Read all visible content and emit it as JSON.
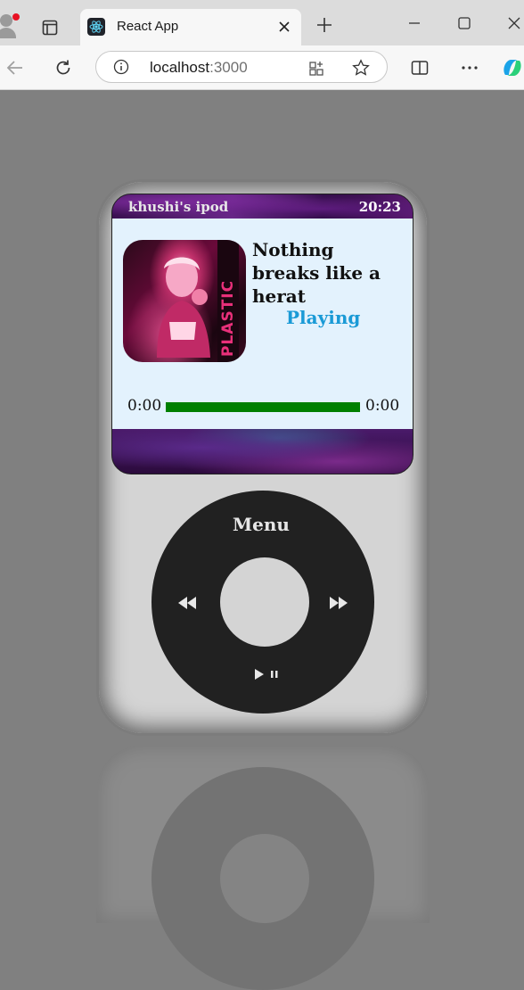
{
  "browser": {
    "tab_title": "React App",
    "url_host": "localhost",
    "url_port": ":3000"
  },
  "ipod": {
    "owner_label": "khushi's ipod",
    "clock": "20:23",
    "song_title": "Nothing breaks like a herat",
    "status": "Playing",
    "album_art_text": "PLASTIC HEARTS",
    "current_time": "0:00",
    "total_time": "0:00",
    "progress_fraction": 1.0,
    "colors": {
      "screen_bg": "#e3f2fd",
      "status": "#1a9ad6",
      "progress": "#008000",
      "wheel": "#212121",
      "body": "#d4d4d4"
    },
    "wheel": {
      "menu_label": "Menu",
      "prev_icon": "rewind-icon",
      "next_icon": "fast-forward-icon",
      "play_pause_icon": "play-pause-icon"
    }
  }
}
